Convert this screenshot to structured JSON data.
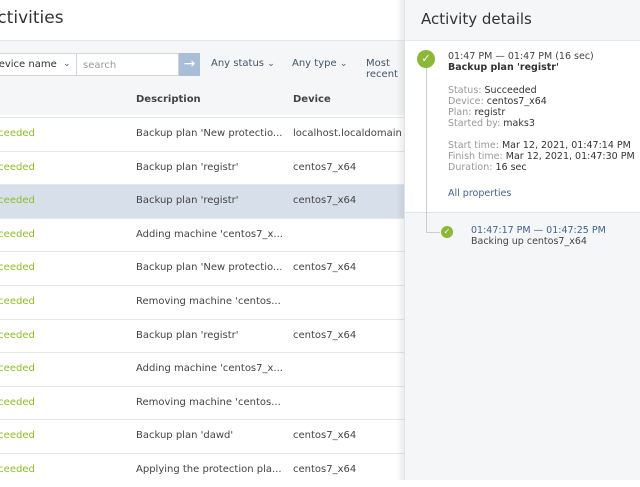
{
  "page": {
    "title": "Activities"
  },
  "toolbar": {
    "filter_select": "Device name",
    "search_placeholder": "search",
    "status_filter": "Any status",
    "type_filter": "Any type",
    "sort": "Most recent"
  },
  "table": {
    "headers": {
      "description": "Description",
      "device": "Device"
    },
    "rows": [
      {
        "status": "Succeeded",
        "description": "Backup plan 'New protectio...",
        "device": "localhost.localdomain"
      },
      {
        "status": "Succeeded",
        "description": "Backup plan 'registr'",
        "device": "centos7_x64"
      },
      {
        "status": "Succeeded",
        "description": "Backup plan 'registr'",
        "device": "centos7_x64",
        "selected": true
      },
      {
        "status": "Succeeded",
        "description": "Adding machine 'centos7_x...",
        "device": ""
      },
      {
        "status": "Succeeded",
        "description": "Backup plan 'New protectio...",
        "device": "centos7_x64"
      },
      {
        "status": "Succeeded",
        "description": "Removing machine 'centos...",
        "device": ""
      },
      {
        "status": "Succeeded",
        "description": "Backup plan 'registr'",
        "device": "centos7_x64"
      },
      {
        "status": "Succeeded",
        "description": "Adding machine 'centos7_x...",
        "device": ""
      },
      {
        "status": "Succeeded",
        "description": "Removing machine 'centos...",
        "device": ""
      },
      {
        "status": "Succeeded",
        "description": "Backup plan 'dawd'",
        "device": "centos7_x64"
      },
      {
        "status": "Succeeded",
        "description": "Applying the protection pla...",
        "device": "centos7_x64"
      }
    ]
  },
  "details": {
    "title": "Activity details",
    "time_range": "01:47 PM — 01:47 PM (16 sec)",
    "name": "Backup plan 'registr'",
    "status_label": "Status:",
    "status": "Succeeded",
    "device_label": "Device:",
    "device": "centos7_x64",
    "plan_label": "Plan:",
    "plan": "registr",
    "started_by_label": "Started by:",
    "started_by": "maks3",
    "start_label": "Start time:",
    "start": "Mar 12, 2021, 01:47:14 PM",
    "finish_label": "Finish time:",
    "finish": "Mar 12, 2021, 01:47:30 PM",
    "duration_label": "Duration:",
    "duration": "16 sec",
    "all_properties": "All properties",
    "sub": {
      "time_range": "01:47:17 PM — 01:47:25 PM",
      "name": "Backing up centos7_x64"
    }
  },
  "colors": {
    "success": "#8cb83a",
    "selected_row": "#d6dfea"
  }
}
